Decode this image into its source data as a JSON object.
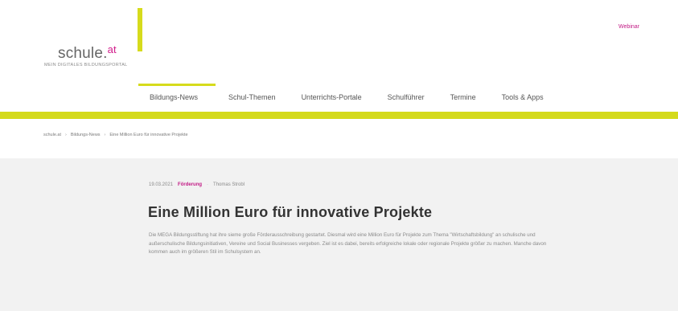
{
  "logo": {
    "word": "schule.",
    "suffix": "at",
    "tagline": "MEIN DIGITALES BILDUNGSPORTAL"
  },
  "header": {
    "top_link": "Webinar"
  },
  "nav": {
    "items": [
      {
        "label": "Bildungs-News"
      },
      {
        "label": "Schul-Themen"
      },
      {
        "label": "Unterrichts-Portale"
      },
      {
        "label": "Schulführer"
      },
      {
        "label": "Termine"
      },
      {
        "label": "Tools & Apps"
      }
    ]
  },
  "breadcrumb": {
    "items": [
      "schule.at",
      "Bildungs-News",
      "Eine Million Euro für innovative Projekte"
    ],
    "separator": "›"
  },
  "article": {
    "date": "19.03.2021",
    "category": "Förderung",
    "separator": "·",
    "author": "Thomas Strobl",
    "title": "Eine Million Euro für innovative Projekte",
    "teaser": "Die MEGA Bildungsstiftung hat ihre sieme große Förderausschreibung gestartet. Diesmal wird eine Million Euro für Projekte zum Thema \"Wirtschaftsbildung\" an schulische und außerschulische Bildungsinitiativen, Vereine und Social Businesses vergeben. Ziel ist es dabei, bereits erfolgreiche lokale oder regionale Projekte größer zu machen. Manche davon kommen auch im größeren Stil im Schulsystem an."
  },
  "colors": {
    "accent_yellow": "#d4da1b",
    "accent_magenta": "#c21a85",
    "article_bg": "#f2f2f2"
  }
}
